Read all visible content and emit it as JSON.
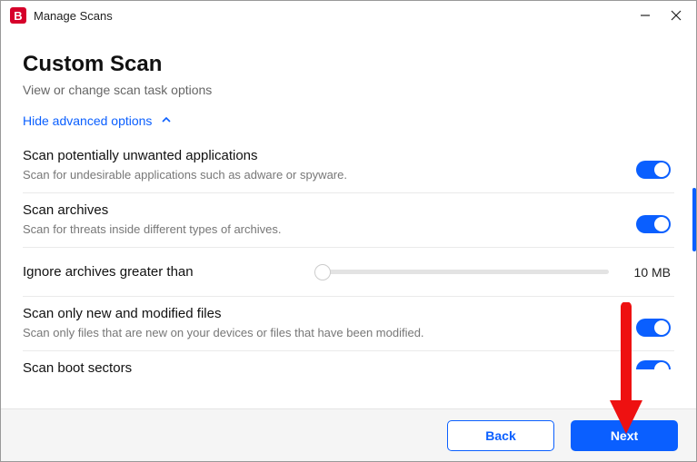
{
  "window": {
    "title": "Manage Scans",
    "app_icon_letter": "B"
  },
  "page": {
    "title": "Custom Scan",
    "subtitle": "View or change scan task options",
    "advanced_toggle": "Hide advanced options"
  },
  "options": {
    "pua": {
      "title": "Scan potentially unwanted applications",
      "desc": "Scan for undesirable applications such as adware or spyware."
    },
    "archives": {
      "title": "Scan archives",
      "desc": "Scan for threats inside different types of archives."
    },
    "ignore_archives": {
      "label": "Ignore archives greater than",
      "value": "10 MB"
    },
    "new_modified": {
      "title": "Scan only new and modified files",
      "desc": "Scan only files that are new on your devices or files that have been modified."
    },
    "boot": {
      "title": "Scan boot sectors"
    }
  },
  "footer": {
    "back": "Back",
    "next": "Next"
  }
}
